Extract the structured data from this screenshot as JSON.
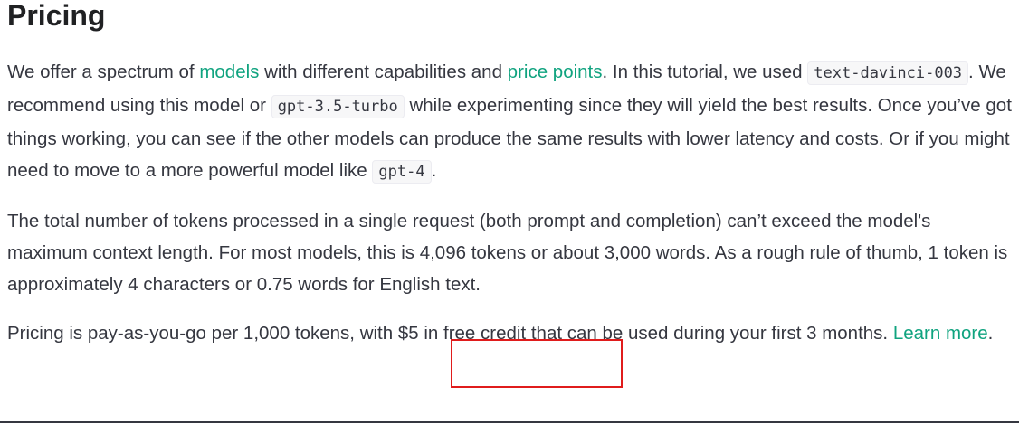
{
  "heading": "Pricing",
  "p1": {
    "t1": "We offer a spectrum of ",
    "link_models": "models",
    "t2": " with different capabilities and ",
    "link_price_points": "price points",
    "t3": ". In this tutorial, we used ",
    "code1": "text-davinci-003",
    "t4": ". We recommend using this model or ",
    "code2": "gpt-3.5-turbo",
    "t5": " while experimenting since they will yield the best results. Once you’ve got things working, you can see if the other models can produce the same results with lower latency and costs. Or if you might need to move to a more powerful model like ",
    "code3": "gpt-4",
    "t6": "."
  },
  "p2": {
    "text": "The total number of tokens processed in a single request (both prompt and completion) can’t exceed the model's maximum context length. For most models, this is 4,096 tokens or about 3,000 words. As a rough rule of thumb, 1 token is approximately 4 characters or 0.75 words for English text."
  },
  "p3": {
    "t1": "Pricing is pay-as-you-go per 1,000 tokens, with $5 in free credit that can be used during your first 3 months. ",
    "link_learn_more": "Learn more",
    "t2": "."
  },
  "colors": {
    "link": "#10a37f",
    "highlight_box": "#e01c1c",
    "text": "#353740"
  }
}
